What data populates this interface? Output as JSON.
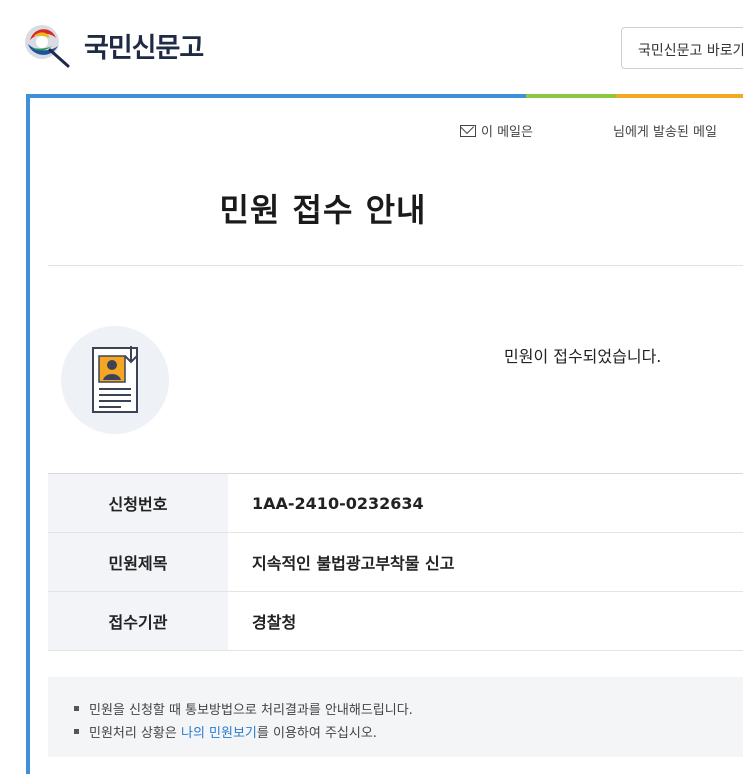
{
  "header": {
    "logo_text": "국민신문고",
    "shortcut_label": "국민신문고 바로가기"
  },
  "mail_note": {
    "prefix": "이 메일은",
    "suffix": "님에게 발송된 메일"
  },
  "title": "민원 접수 안내",
  "message": "민원이 접수되었습니다.",
  "table": {
    "rows": [
      {
        "label": "신청번호",
        "value": "1AA-2410-0232634"
      },
      {
        "label": "민원제목",
        "value": "지속적인 불법광고부착물 신고"
      },
      {
        "label": "접수기관",
        "value": "경찰청"
      }
    ]
  },
  "notes": {
    "line1": "민원을 신청할 때 통보방법으로 처리결과를 안내해드립니다.",
    "line2_prefix": "민원처리 상황은 ",
    "line2_link": "나의 민원보기",
    "line2_suffix": "를 이용하여 주십시오."
  },
  "colors": {
    "accent_blue": "#3f8fd9",
    "accent_green": "#8dc63f",
    "accent_orange": "#f5a623"
  }
}
